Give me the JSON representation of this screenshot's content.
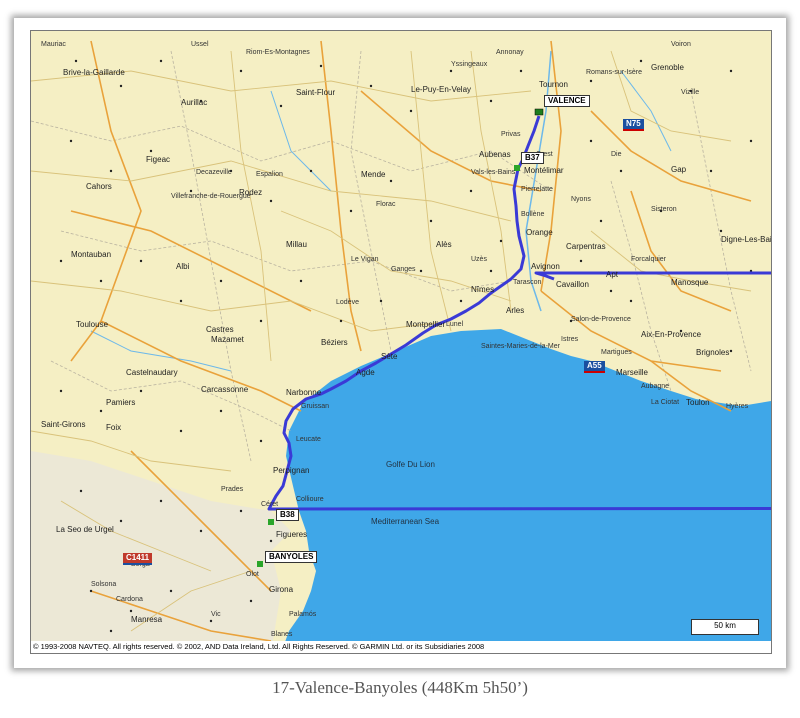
{
  "caption": "17-Valence-Banyoles (448Km 5h50’)",
  "copyright": "© 1993-2008 NAVTEQ.  All rights reserved.  © 2002, AND Data Ireland, Ltd.  All Rights Reserved.  © GARMIN Ltd. or its Subsidiaries 2008",
  "scale_label": "50 km",
  "route_labels": {
    "start": "VALENCE",
    "end": "BANYOLES",
    "b37": "B37",
    "b38": "B38"
  },
  "shields": {
    "n75": "N75",
    "a55": "A55",
    "c1411": "C1411"
  },
  "sea_labels": {
    "golfe": "Golfe Du Lion",
    "med": "Mediterranean Sea"
  },
  "places": {
    "brive": "Brive-la-Gaillarde",
    "aurillac": "Aurillac",
    "saintflour": "Saint-Flour",
    "lepuy": "Le-Puy-En-Velay",
    "tournon": "Tournon",
    "grenoble": "Grenoble",
    "figeac": "Figeac",
    "cahors": "Cahors",
    "rodez": "Rodez",
    "millau": "Millau",
    "mende": "Mende",
    "aubenas": "Aubenas",
    "privas": "Privas",
    "crest": "Crest",
    "montelimar": "Montélimar",
    "gap": "Gap",
    "nyons": "Nyons",
    "orange": "Orange",
    "carpentras": "Carpentras",
    "avignon": "Avignon",
    "ales": "Alès",
    "nimes": "Nîmes",
    "arles": "Arles",
    "cavaillon": "Cavaillon",
    "apt": "Apt",
    "manosque": "Manosque",
    "montauban": "Montauban",
    "albi": "Albi",
    "toulouse": "Toulouse",
    "castres": "Castres",
    "mazamet": "Mazamet",
    "lodeve": "Lodève",
    "montpellier": "Montpellier",
    "beziers": "Béziers",
    "sete": "Sète",
    "agde": "Agde",
    "narbonne": "Narbonne",
    "carcassonne": "Carcassonne",
    "castelnaudary": "Castelnaudary",
    "pamiers": "Pamiers",
    "foix": "Foix",
    "saintgirons": "Saint-Girons",
    "perpignan": "Perpignan",
    "figueres": "Figueres",
    "girona": "Girona",
    "seodeurgel": "La Seo de Urgel",
    "aixenprovence": "Aix-En-Provence",
    "marseille": "Marseille",
    "brignoles": "Brignoles",
    "toulon": "Toulon",
    "saintesmaries": "Saintes-Maries-de-la-Mer",
    "sisteron": "Sisteron",
    "digne": "Digne-Les-Bains",
    "valence": "Valence",
    "manresa": "Manresa",
    "solsona": "Solsona",
    "berga": "Berga",
    "palamos": "Palamós",
    "blanes": "Blanes",
    "collioure": "Collioure",
    "ceret": "Céret",
    "vals": "Vals-les-Bains",
    "laciotat": "La Ciotat",
    "villefranche": "Villefranche-de-Rouergue",
    "decazeville": "Decazeville",
    "espalion": "Espalion",
    "florac": "Florac",
    "levigan": "Le Vigan",
    "ganges": "Ganges",
    "bollene": "Bollène",
    "pierrelatte": "Pierrelatte",
    "uzes": "Uzès",
    "lunel": "Lunel",
    "gruissan": "Gruissan",
    "leucate": "Leucate",
    "prades": "Prades",
    "vic": "Vic",
    "cardona": "Cardona",
    "olot": "Olot",
    "salon": "Salon-de-Provence",
    "istres": "Istres",
    "martigues": "Martigues",
    "aubagne": "Aubagne",
    "hyeres": "Hyères",
    "forcalquier": "Forcalquier",
    "mauriac": "Mauriac",
    "ussel": "Ussel",
    "riom": "Riom-Es-Montagnes",
    "yssingeaux": "Yssingeaux",
    "annonay": "Annonay",
    "romans": "Romans-sur-Isère",
    "voiron": "Voiron",
    "vizille": "Vizille",
    "diois": "Die",
    "tarascon": "Tarascon"
  }
}
